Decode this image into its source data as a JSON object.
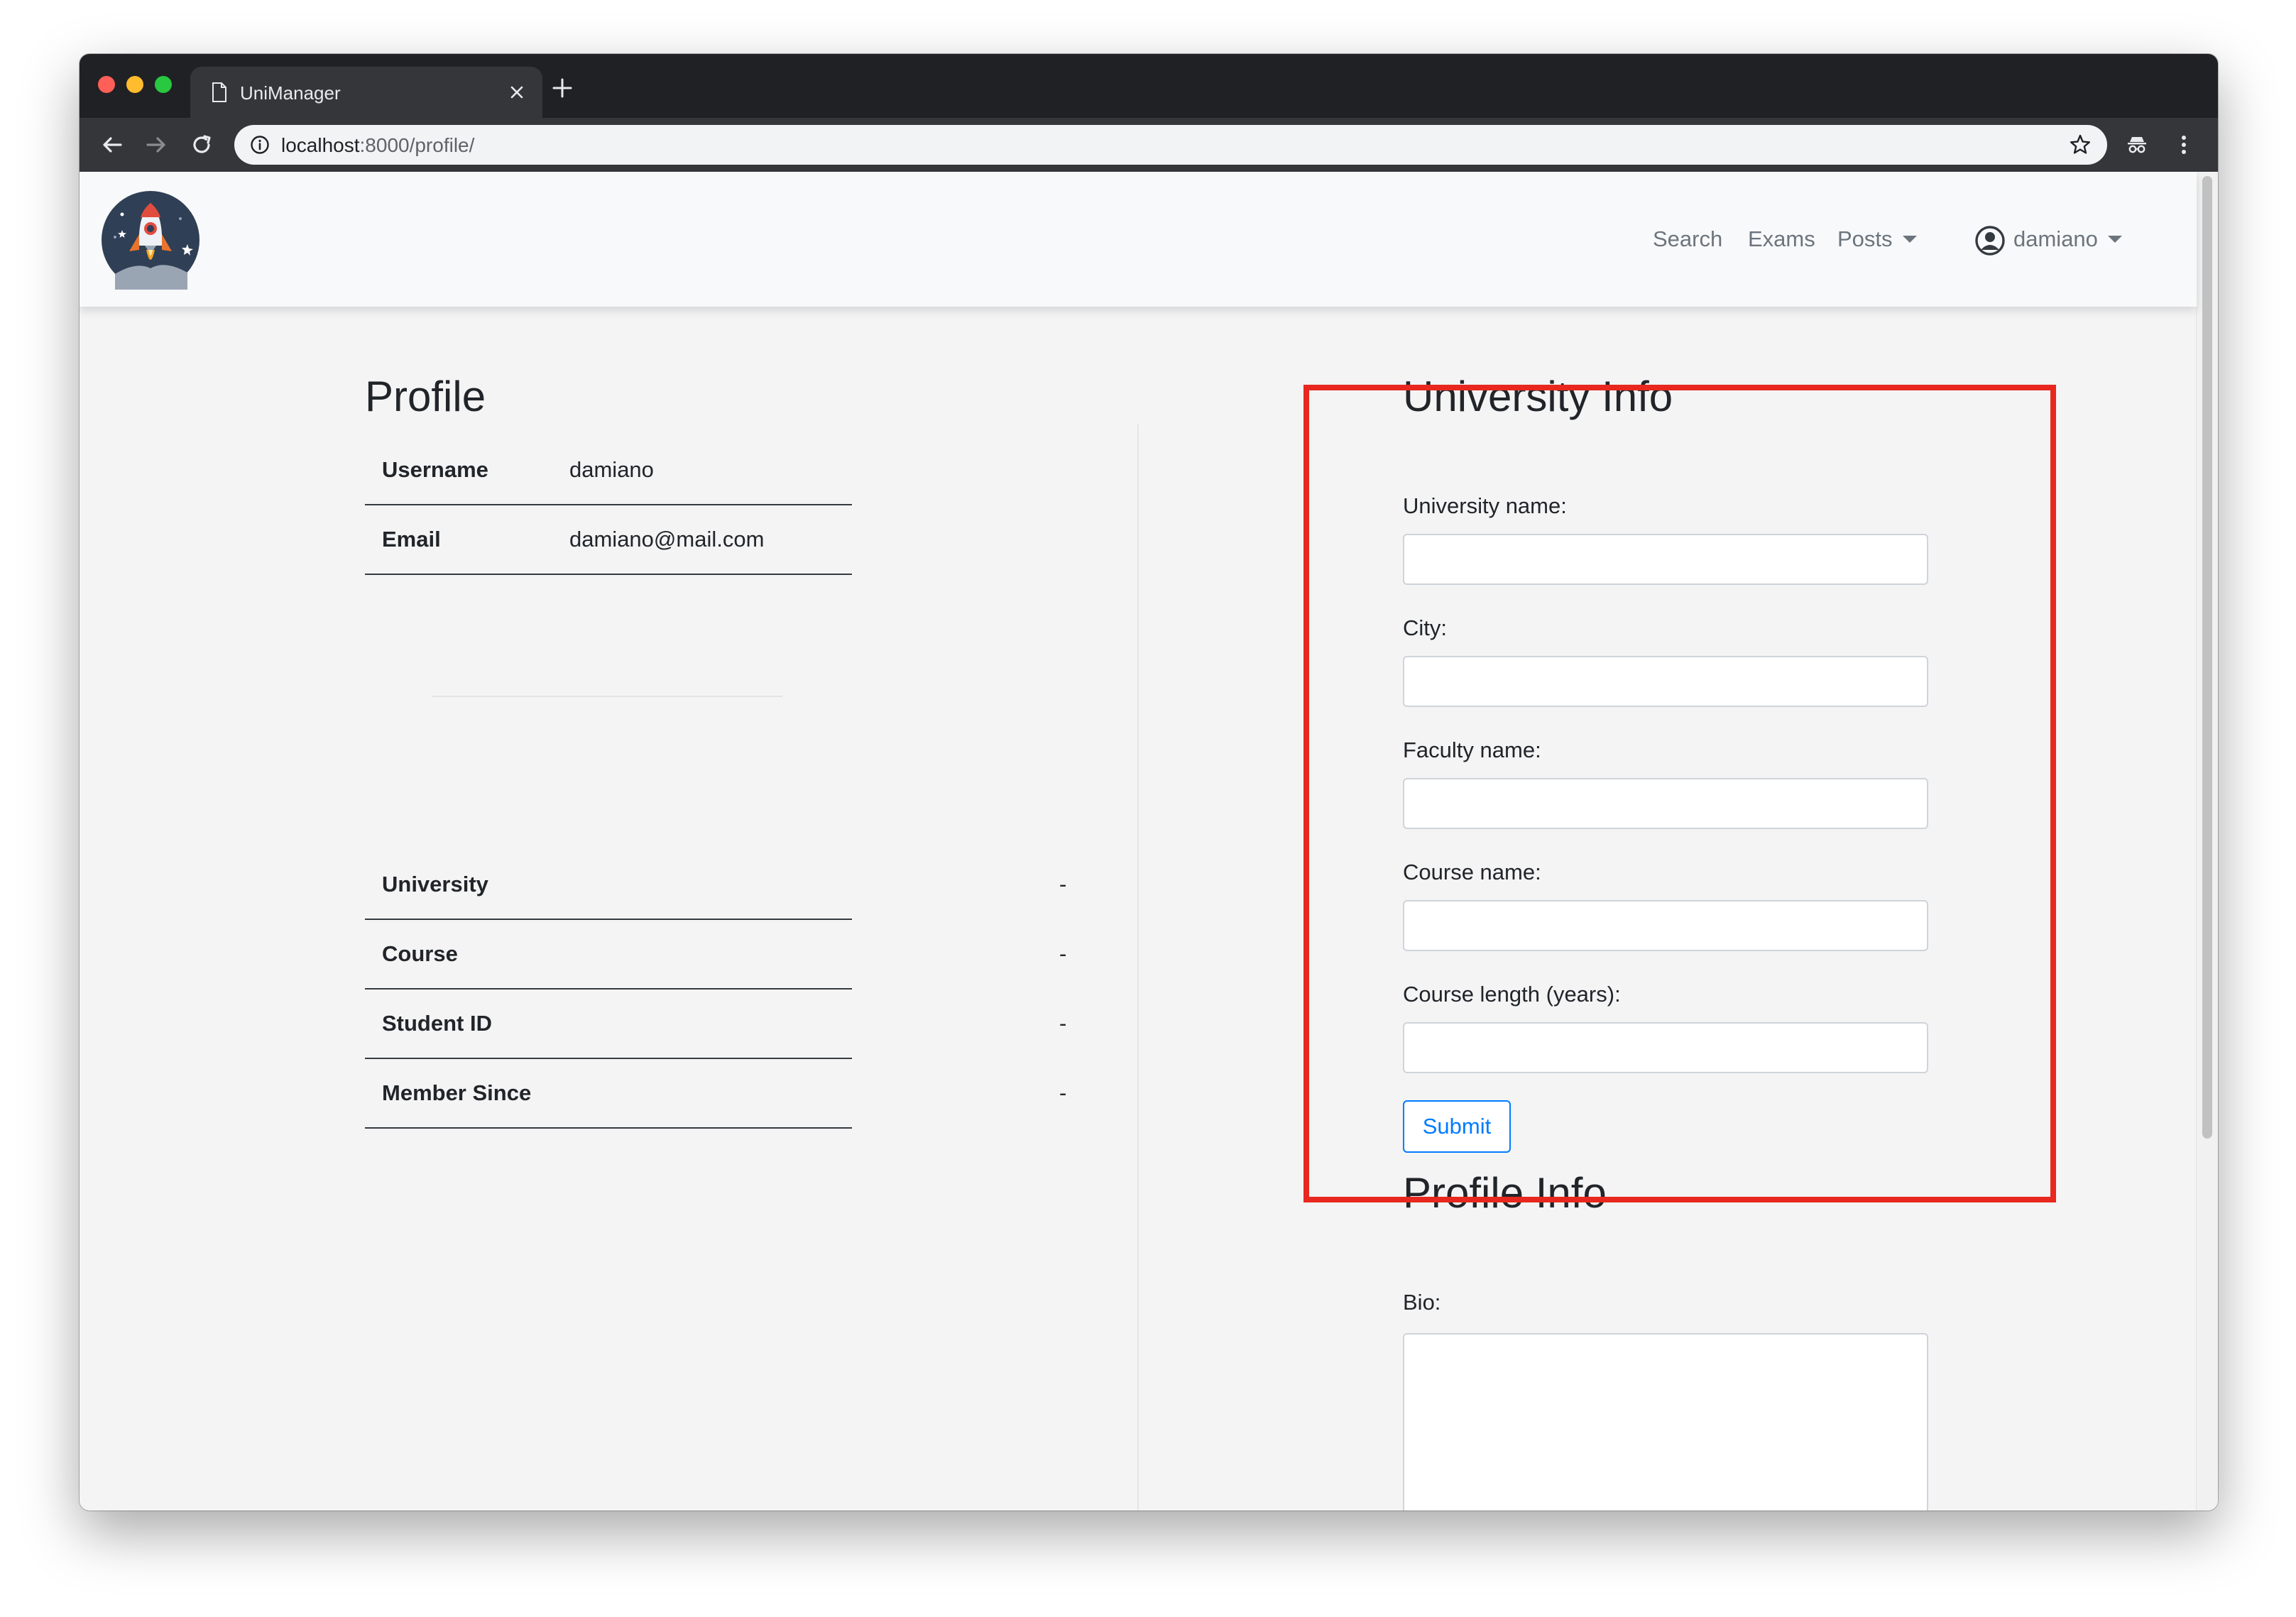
{
  "browser": {
    "tab_title": "UniManager",
    "url_host": "localhost",
    "url_rest": ":8000/profile/"
  },
  "navbar": {
    "links": {
      "search": "Search",
      "exams": "Exams",
      "posts": "Posts"
    },
    "user": "damiano"
  },
  "profile": {
    "title": "Profile",
    "account_rows": [
      {
        "label": "Username",
        "value": "damiano"
      },
      {
        "label": "Email",
        "value": "damiano@mail.com"
      }
    ],
    "details_rows": [
      {
        "label": "University",
        "value": "-"
      },
      {
        "label": "Course",
        "value": "-"
      },
      {
        "label": "Student ID",
        "value": "-"
      },
      {
        "label": "Member Since",
        "value": "-"
      }
    ]
  },
  "university_form": {
    "title": "University Info",
    "fields": [
      {
        "label": "University name:",
        "value": ""
      },
      {
        "label": "City:",
        "value": ""
      },
      {
        "label": "Faculty name:",
        "value": ""
      },
      {
        "label": "Course name:",
        "value": ""
      },
      {
        "label": "Course length (years):",
        "value": ""
      }
    ],
    "submit_label": "Submit"
  },
  "profile_form": {
    "title": "Profile Info",
    "bio_label": "Bio:",
    "bio_value": ""
  },
  "colors": {
    "highlight": "#e8281f",
    "primary": "#007bff",
    "nav_text": "#6c757d",
    "page_bg": "#f4f4f5"
  }
}
